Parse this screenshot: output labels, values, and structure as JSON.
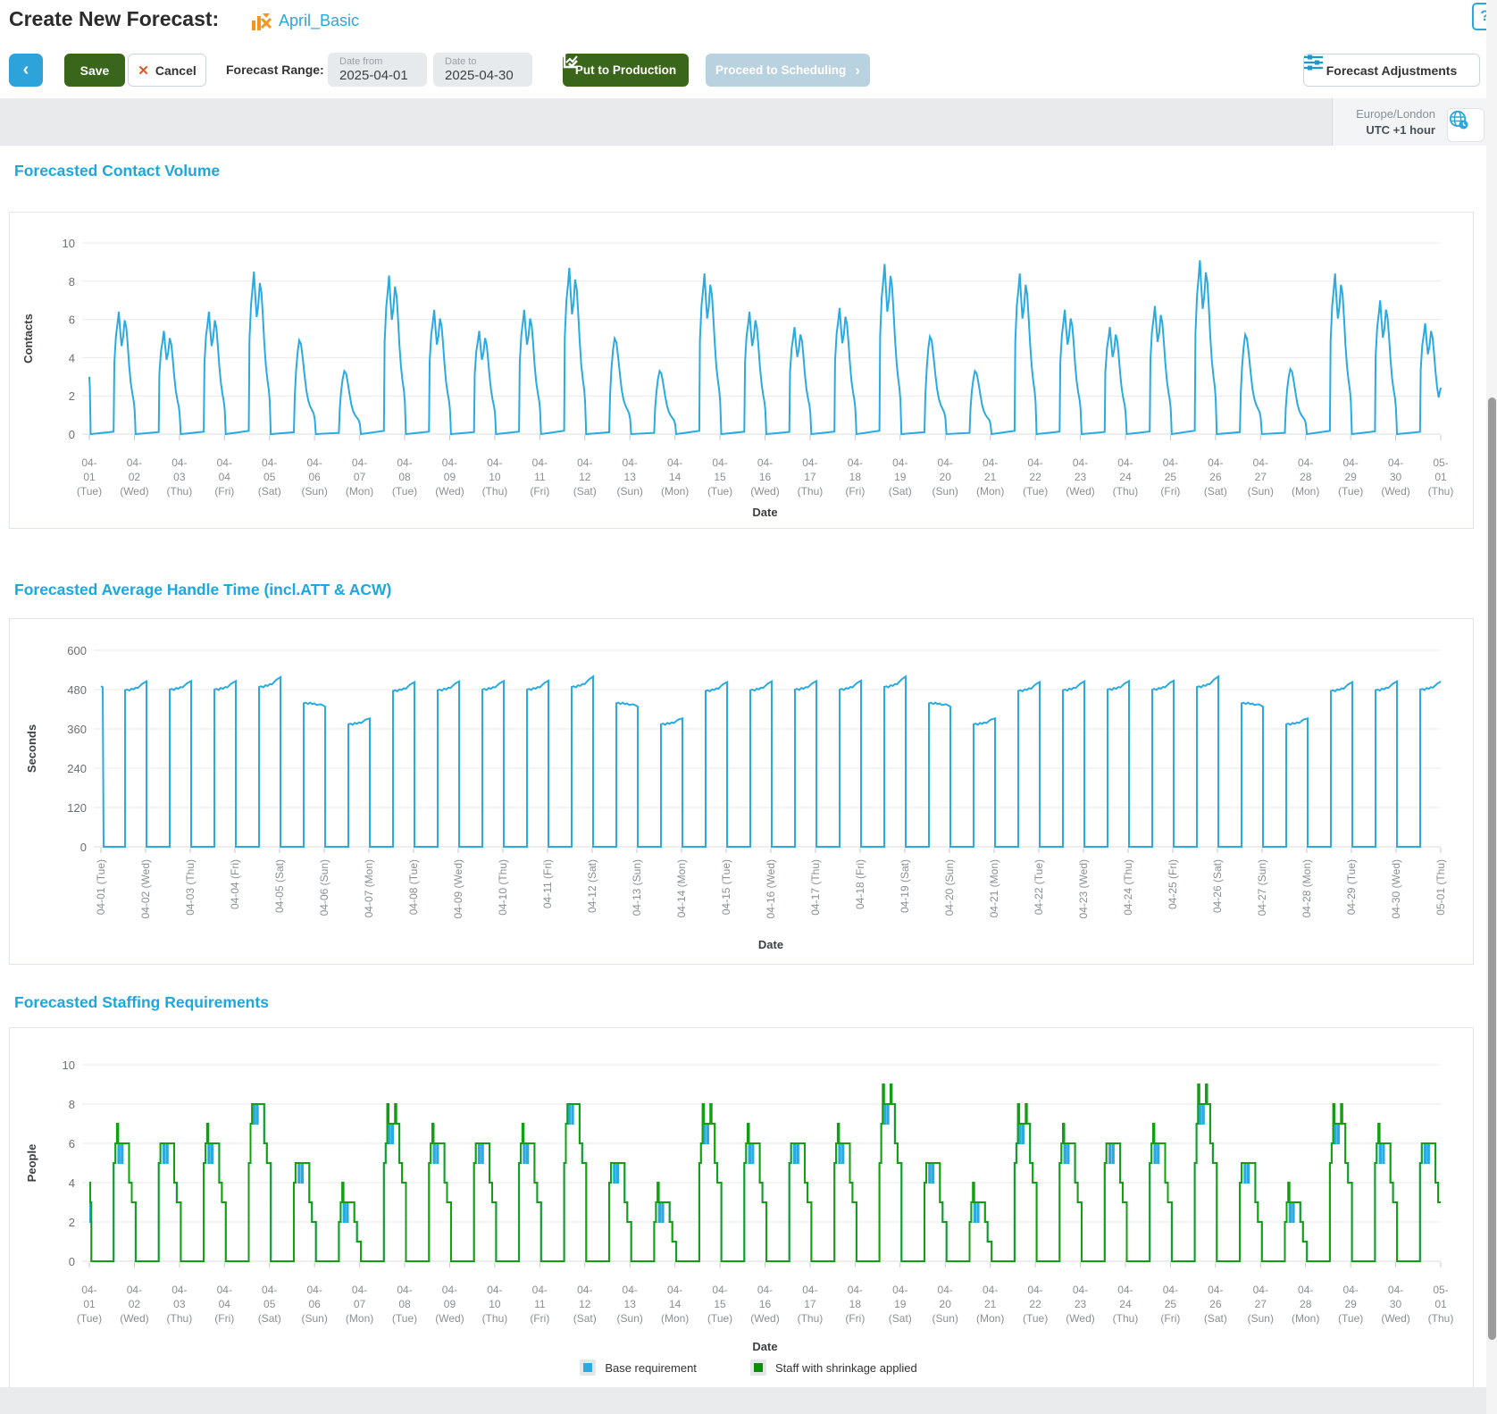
{
  "header": {
    "title": "Create New Forecast:",
    "forecast_name": "April_Basic",
    "forecast_icon": "forecast-chart-icon",
    "help_icon": "question-mark"
  },
  "toolbar": {
    "back_chevron": "‹",
    "save_label": "Save",
    "cancel_label": "Cancel",
    "cancel_icon": "✕",
    "range_label": "Forecast Range:",
    "date_from": {
      "label": "Date from",
      "value": "2025-04-01"
    },
    "date_to": {
      "label": "Date to",
      "value": "2025-04-30"
    },
    "put_to_production_label": "Put to Production",
    "proceed_label": "Proceed to Scheduling",
    "proceed_chevron": "›",
    "adjustments_label": "Forecast Adjustments"
  },
  "timezone": {
    "region": "Europe/London",
    "offset": "UTC +1 hour",
    "icon": "globe-clock-icon"
  },
  "sections": {
    "contact_volume_title": "Forecasted Contact Volume",
    "aht_title": "Forecasted Average Handle Time (incl.ATT & ACW)",
    "staffing_title": "Forecasted Staffing Requirements"
  },
  "legend": {
    "base_label": "Base requirement",
    "shrinkage_label": "Staff with shrinkage applied"
  },
  "colors": {
    "line_blue": "#29abe2",
    "line_green": "#11a011",
    "legend_blue": "#29abe2",
    "legend_green": "#0b8f0b",
    "heading_blue": "#1ba7e0",
    "button_green": "#3a661b",
    "disabled_blue": "#b9d2e0",
    "accent_orange": "#f7941e",
    "grid": "#e9e9e9",
    "tick_text": "#8a8f94"
  },
  "chart_data": {
    "dates": [
      {
        "date": "04-01",
        "dow": "Tue"
      },
      {
        "date": "04-02",
        "dow": "Wed"
      },
      {
        "date": "04-03",
        "dow": "Thu"
      },
      {
        "date": "04-04",
        "dow": "Fri"
      },
      {
        "date": "04-05",
        "dow": "Sat"
      },
      {
        "date": "04-06",
        "dow": "Sun"
      },
      {
        "date": "04-07",
        "dow": "Mon"
      },
      {
        "date": "04-08",
        "dow": "Tue"
      },
      {
        "date": "04-09",
        "dow": "Wed"
      },
      {
        "date": "04-10",
        "dow": "Thu"
      },
      {
        "date": "04-11",
        "dow": "Fri"
      },
      {
        "date": "04-12",
        "dow": "Sat"
      },
      {
        "date": "04-13",
        "dow": "Sun"
      },
      {
        "date": "04-14",
        "dow": "Mon"
      },
      {
        "date": "04-15",
        "dow": "Tue"
      },
      {
        "date": "04-16",
        "dow": "Wed"
      },
      {
        "date": "04-17",
        "dow": "Thu"
      },
      {
        "date": "04-18",
        "dow": "Fri"
      },
      {
        "date": "04-19",
        "dow": "Sat"
      },
      {
        "date": "04-20",
        "dow": "Sun"
      },
      {
        "date": "04-21",
        "dow": "Mon"
      },
      {
        "date": "04-22",
        "dow": "Tue"
      },
      {
        "date": "04-23",
        "dow": "Wed"
      },
      {
        "date": "04-24",
        "dow": "Thu"
      },
      {
        "date": "04-25",
        "dow": "Fri"
      },
      {
        "date": "04-26",
        "dow": "Sat"
      },
      {
        "date": "04-27",
        "dow": "Sun"
      },
      {
        "date": "04-28",
        "dow": "Mon"
      },
      {
        "date": "04-29",
        "dow": "Tue"
      },
      {
        "date": "04-30",
        "dow": "Wed"
      },
      {
        "date": "05-01",
        "dow": "Thu"
      }
    ],
    "contact_volume": {
      "type": "line",
      "title": "Forecasted Contact Volume",
      "xlabel": "Date",
      "ylabel": "Contacts",
      "ylim": [
        0,
        10
      ],
      "yticks": [
        0,
        2,
        4,
        6,
        8,
        10
      ],
      "first_day_partial": true,
      "last_day_partial": true,
      "daily_peak": [
        3,
        6.4,
        5.4,
        6.4,
        8.5,
        4.9,
        3.3,
        8.3,
        6.5,
        5.4,
        6.5,
        8.7,
        5.0,
        3.3,
        8.4,
        6.4,
        5.6,
        6.6,
        8.9,
        5.1,
        3.3,
        8.4,
        6.5,
        5.6,
        6.7,
        9.1,
        5.2,
        3.4,
        8.4,
        7.0,
        5.8
      ]
    },
    "average_handle_time": {
      "type": "line",
      "title": "Forecasted Average Handle Time (incl.ATT & ACW)",
      "xlabel": "Date",
      "ylabel": "Seconds",
      "ylim": [
        0,
        600
      ],
      "yticks": [
        0,
        120,
        240,
        360,
        480,
        600
      ],
      "first_day_partial": true,
      "last_day_partial": true,
      "daily_start": [
        490,
        478,
        480,
        480,
        488,
        438,
        374,
        476,
        478,
        480,
        480,
        488,
        438,
        374,
        476,
        478,
        480,
        480,
        488,
        438,
        374,
        476,
        478,
        480,
        480,
        488,
        438,
        374,
        476,
        478,
        480
      ],
      "daily_end": [
        490,
        505,
        506,
        506,
        518,
        428,
        392,
        503,
        505,
        506,
        507,
        520,
        428,
        392,
        503,
        505,
        506,
        507,
        520,
        428,
        392,
        503,
        505,
        506,
        507,
        520,
        428,
        392,
        503,
        505,
        505
      ]
    },
    "staffing": {
      "type": "line",
      "title": "Forecasted Staffing Requirements",
      "xlabel": "Date",
      "ylabel": "People",
      "ylim": [
        0,
        10
      ],
      "yticks": [
        0,
        2,
        4,
        6,
        8,
        10
      ],
      "first_day_partial": true,
      "last_day_partial": true,
      "series": [
        {
          "name": "Base requirement",
          "color": "#29abe2",
          "daily_peak": [
            3,
            6,
            6,
            6,
            8,
            5,
            3,
            7,
            6,
            6,
            6,
            8,
            5,
            3,
            7,
            6,
            6,
            6,
            8,
            5,
            3,
            7,
            6,
            6,
            6,
            8,
            5,
            3,
            7,
            6,
            6
          ]
        },
        {
          "name": "Staff with shrinkage applied",
          "color": "#11a011",
          "daily_peak": [
            4,
            7,
            6,
            7,
            8,
            5,
            4,
            8,
            7,
            6,
            7,
            8,
            5,
            4,
            8,
            7,
            6,
            7,
            9,
            5,
            4,
            8,
            7,
            6,
            7,
            9,
            5,
            4,
            8,
            7,
            6
          ]
        }
      ]
    }
  }
}
